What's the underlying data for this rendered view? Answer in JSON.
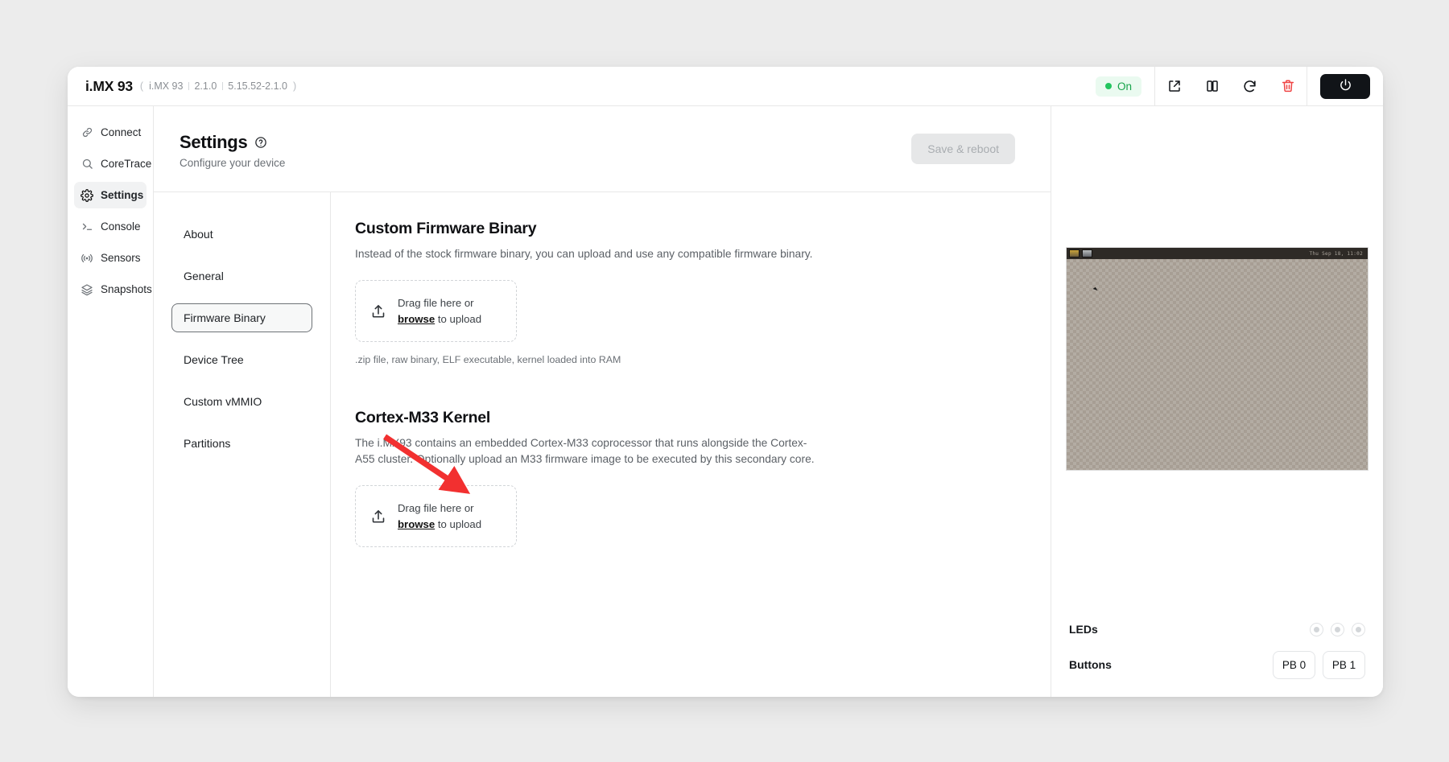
{
  "titlebar": {
    "device_name": "i.MX 93",
    "meta": [
      "i.MX 93",
      "2.1.0",
      "5.15.52-2.1.0"
    ],
    "status_label": "On",
    "status_color": "#22c55e",
    "actions": [
      {
        "name": "open-external-button",
        "icon": "external-link-icon"
      },
      {
        "name": "pause-button",
        "icon": "pause-icon"
      },
      {
        "name": "restart-button",
        "icon": "refresh-icon"
      },
      {
        "name": "delete-button",
        "icon": "trash-icon",
        "color": "#ef4444"
      }
    ],
    "power_icon": "power-icon"
  },
  "sidebar": {
    "items": [
      {
        "label": "Connect",
        "icon": "link-icon",
        "active": false
      },
      {
        "label": "CoreTrace",
        "icon": "search-icon",
        "active": false
      },
      {
        "label": "Settings",
        "icon": "gear-icon",
        "active": true
      },
      {
        "label": "Console",
        "icon": "terminal-icon",
        "active": false
      },
      {
        "label": "Sensors",
        "icon": "signal-icon",
        "active": false
      },
      {
        "label": "Snapshots",
        "icon": "layers-icon",
        "active": false
      }
    ]
  },
  "settings": {
    "title": "Settings",
    "help_icon": "question-circle-icon",
    "subtitle": "Configure your device",
    "save_label": "Save & reboot",
    "save_disabled": true,
    "subnav": [
      {
        "label": "About",
        "active": false
      },
      {
        "label": "General",
        "active": false
      },
      {
        "label": "Firmware Binary",
        "active": true
      },
      {
        "label": "Device Tree",
        "active": false
      },
      {
        "label": "Custom vMMIO",
        "active": false
      },
      {
        "label": "Partitions",
        "active": false
      }
    ]
  },
  "sections": [
    {
      "title": "Custom Firmware Binary",
      "description": "Instead of the stock firmware binary, you can upload and use any compatible firmware binary.",
      "dropzone": {
        "icon": "upload-icon",
        "line1": "Drag file here or",
        "browse": "browse",
        "line2_suffix": " to upload"
      },
      "hint": ".zip file, raw binary, ELF executable, kernel loaded into RAM"
    },
    {
      "title": "Cortex-M33 Kernel",
      "description": "The i.MX93 contains an embedded Cortex-M33 coprocessor that runs alongside the Cortex-A55 cluster. Optionally upload an M33 firmware image to be executed by this secondary core.",
      "dropzone": {
        "icon": "upload-icon",
        "line1": "Drag file here or",
        "browse": "browse",
        "line2_suffix": " to upload"
      },
      "hint": ""
    }
  ],
  "device_panel": {
    "screen": {
      "taskbar_clock": "Thu Sep 18, 11:02",
      "taskbar_icons": [
        "app-icon",
        "window-icon"
      ],
      "cursor": "mouse-cursor"
    },
    "leds": {
      "label": "LEDs",
      "count": 3,
      "states": [
        "off",
        "off",
        "off"
      ]
    },
    "buttons": {
      "label": "Buttons",
      "items": [
        "PB 0",
        "PB 1"
      ]
    }
  },
  "annotation": {
    "arrow_color": "#f23030",
    "target": "cortex-m33-dropzone"
  }
}
